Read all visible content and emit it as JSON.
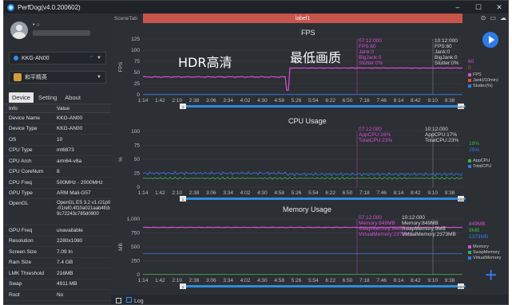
{
  "window": {
    "title": "PerfDog(v4.0.200602)",
    "controls": [
      "–",
      "☐",
      "✕"
    ]
  },
  "user": {
    "name": "•  ○"
  },
  "device_select": {
    "value": "KKG-AN00"
  },
  "app_select": {
    "value": "和平精英"
  },
  "tabs": [
    "Device",
    "Setting",
    "About"
  ],
  "info": {
    "header": [
      "Info",
      "Value"
    ],
    "rows": [
      [
        "Device Name",
        "KKG-AN00"
      ],
      [
        "Device Type",
        "KKG-AN00"
      ],
      [
        "OS",
        "10"
      ],
      [
        "CPU Type",
        "mt6873"
      ],
      [
        "CPU Arch",
        "arm64-v8a"
      ],
      [
        "CPU CoreNum",
        "8"
      ],
      [
        "CPU Freq",
        "500MHz - 2000MHz"
      ],
      [
        "GPU Type",
        "ARM Mali-G57"
      ],
      [
        "OpenGL",
        "OpenGL ES 3.2 v1.r21p0-01rel0.4f10a021aab4fcb9c72243c785d0900"
      ],
      [
        "GPU Freq",
        "unavailable"
      ],
      [
        "Resolution",
        "2280x1080"
      ],
      [
        "Screen Size",
        "7.09 In"
      ],
      [
        "Ram Size",
        "7.4 GB"
      ],
      [
        "LMK Threshold",
        "216MB"
      ],
      [
        "Swap",
        "4911 MB"
      ],
      [
        "Root",
        "No"
      ]
    ]
  },
  "scene": {
    "tab_label": "SceneTab",
    "label": "label1"
  },
  "overlays": {
    "hdr": "HDR高清",
    "lowest": "最低画质"
  },
  "time_ticks": [
    "1:14",
    "1:42",
    "2:10",
    "2:38",
    "3:06",
    "3:34",
    "4:02",
    "4:30",
    "4:58",
    "5:26",
    "5:54",
    "6:22",
    "6:50",
    "7:18",
    "7:46",
    "8:14",
    "8:42",
    "9:10",
    "9:38"
  ],
  "fps": {
    "title": "FPS",
    "yticks": [
      "125",
      "100",
      "75",
      "50",
      "25",
      "0"
    ],
    "ylabel": "FPS",
    "ann_left": [
      "07:12:000",
      "FPS:60",
      "Jank:0",
      "BigJank:0",
      "Stutter:0%"
    ],
    "ann_right": [
      "10:12:000",
      "FPS:60",
      "Jank:0",
      "BigJank:0",
      "Stutter:0%"
    ],
    "right_values": [
      "60",
      "0"
    ],
    "legend": [
      "FPS",
      "Jank(/10min)",
      "Stutter(%)"
    ],
    "scroll_left": "1",
    "scroll_right": "603"
  },
  "cpu": {
    "title": "CPU Usage",
    "yticks": [
      "100",
      "75",
      "50",
      "25",
      "0"
    ],
    "ylabel": "%",
    "ann_left": [
      "07:12:000",
      "AppCPU:16%",
      "TotalCPU:23%"
    ],
    "ann_right": [
      "10:12:000",
      "AppCPU:17%",
      "TotalCPU:23%"
    ],
    "right_values": [
      "18%",
      "25%"
    ],
    "legend": [
      "AppCPU",
      "TotalCPU"
    ],
    "scroll_left": "1",
    "scroll_right": "603"
  },
  "memory": {
    "title": "Memory Usage",
    "yticks": [
      "1,000",
      "750",
      "500",
      "250",
      "0"
    ],
    "ylabel": "MB",
    "ann_left": [
      "07:12:000",
      "Memory:849MB",
      "SwapMemory:9MB",
      "VirtualMemory:2373MB"
    ],
    "ann_right": [
      "10:12:000",
      "Memory:849MB",
      "SwapMemory:9MB",
      "VirtualMemory:2373MB"
    ],
    "right_values": [
      "849MB",
      "9MB",
      "2373MB"
    ],
    "legend": [
      "Memory",
      "SwapMemory",
      "VirtualMemory"
    ],
    "scroll_left": "1",
    "scroll_right": "603"
  },
  "bottom": {
    "log_label": "Log"
  },
  "colors": {
    "magenta": "#d84fd6",
    "blue": "#2f7be8",
    "green": "#39b54a",
    "label_red": "#c8554c"
  }
}
